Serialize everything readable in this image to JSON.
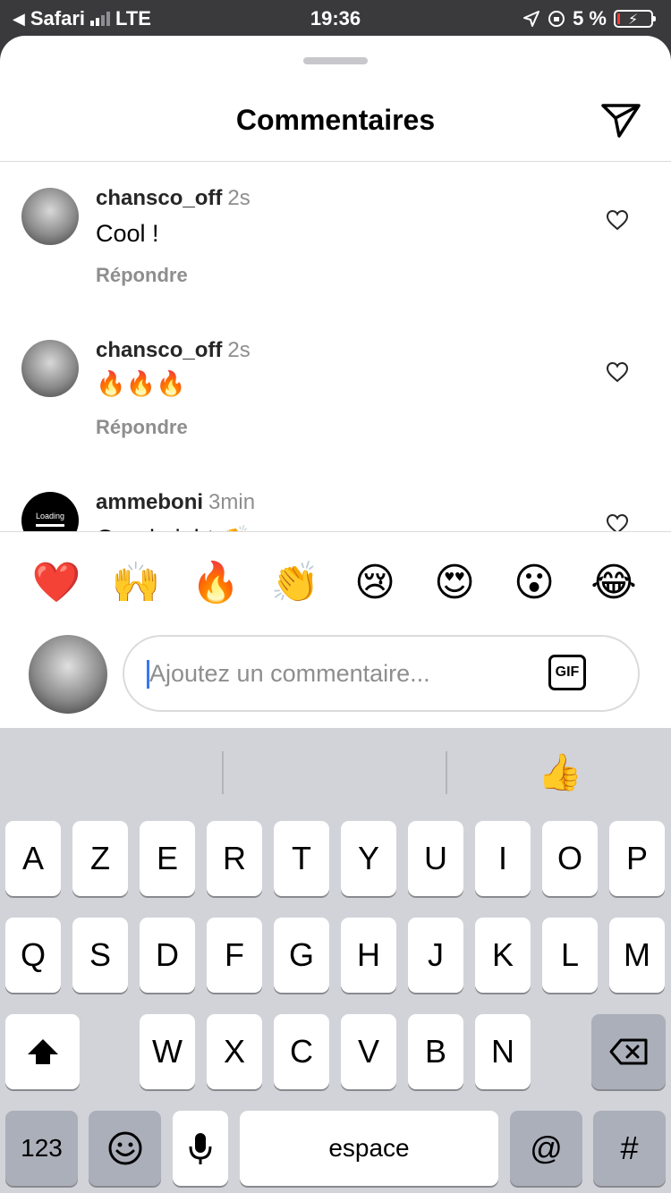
{
  "status_bar": {
    "back_app": "Safari",
    "network": "LTE",
    "time": "19:36",
    "battery": "5 %"
  },
  "sheet": {
    "title": "Commentaires"
  },
  "comments": [
    {
      "username": "chansco_off",
      "time": "2s",
      "text": "Cool !",
      "reply": "Répondre"
    },
    {
      "username": "chansco_off",
      "time": "2s",
      "text": "🔥🔥🔥",
      "reply": "Répondre"
    },
    {
      "username": "ammeboni",
      "time": "3min",
      "text": "Good night 👏",
      "avatar_text": "Loading"
    }
  ],
  "quick_reactions": [
    "❤️",
    "🙌",
    "🔥",
    "👏",
    "😢",
    "😍",
    "😮",
    "😂"
  ],
  "composer": {
    "placeholder": "Ajoutez un commentaire...",
    "gif_label": "GIF"
  },
  "keyboard": {
    "suggestion_emoji": "👍",
    "row1": [
      "A",
      "Z",
      "E",
      "R",
      "T",
      "Y",
      "U",
      "I",
      "O",
      "P"
    ],
    "row2": [
      "Q",
      "S",
      "D",
      "F",
      "G",
      "H",
      "J",
      "K",
      "L",
      "M"
    ],
    "row3": [
      "W",
      "X",
      "C",
      "V",
      "B",
      "N"
    ],
    "numbers_label": "123",
    "space_label": "espace",
    "at_label": "@",
    "hash_label": "#"
  }
}
